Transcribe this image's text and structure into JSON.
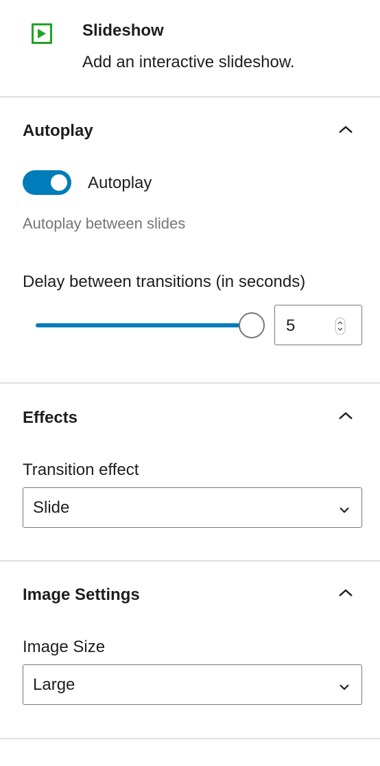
{
  "block": {
    "title": "Slideshow",
    "description": "Add an interactive slideshow.",
    "icon": "slideshow-play-icon",
    "icon_color": "#1fa322"
  },
  "autoplay_panel": {
    "title": "Autoplay",
    "toggle_label": "Autoplay",
    "toggle_on": true,
    "help": "Autoplay between slides",
    "delay_label": "Delay between transitions (in seconds)",
    "delay_value": "5",
    "slider_fraction": 1.0
  },
  "effects_panel": {
    "title": "Effects",
    "transition_label": "Transition effect",
    "transition_value": "Slide"
  },
  "image_panel": {
    "title": "Image Settings",
    "size_label": "Image Size",
    "size_value": "Large"
  },
  "colors": {
    "accent": "#007cba",
    "divider": "#e0e0e0",
    "help_text": "#757575"
  }
}
